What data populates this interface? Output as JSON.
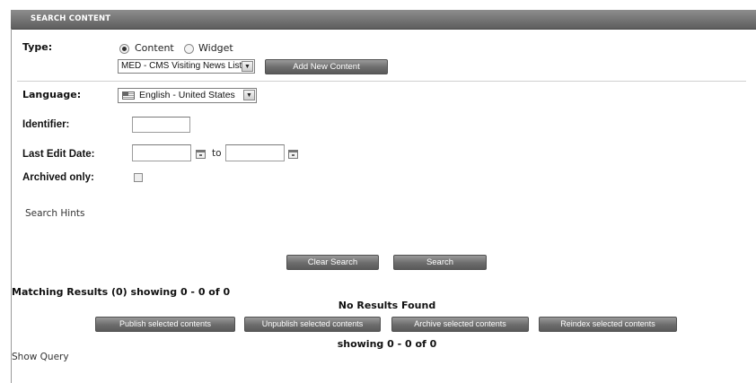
{
  "panel": {
    "title": "SEARCH CONTENT"
  },
  "type_section": {
    "label": "Type:",
    "radios": [
      {
        "label": "Content",
        "checked": true
      },
      {
        "label": "Widget",
        "checked": false
      }
    ],
    "select_value": "MED - CMS Visiting News List",
    "add_button": "Add New Content"
  },
  "language": {
    "label": "Language:",
    "value": "English - United States"
  },
  "identifier": {
    "label": "Identifier:",
    "value": ""
  },
  "last_edit": {
    "label": "Last Edit Date:",
    "to_label": "to",
    "from_value": "",
    "to_value": ""
  },
  "archived": {
    "label": "Archived only:",
    "checked": false
  },
  "search_hints": "Search Hints",
  "buttons": {
    "clear_search": "Clear Search",
    "search": "Search"
  },
  "results": {
    "summary": "Matching Results (0) showing 0 - 0 of 0",
    "none_found": "No Results Found",
    "actions": [
      "Publish selected contents",
      "Unpublish selected contents",
      "Archive selected contents",
      "Reindex selected contents"
    ],
    "footer_showing": "showing 0 - 0 of 0"
  },
  "show_query": "Show Query"
}
